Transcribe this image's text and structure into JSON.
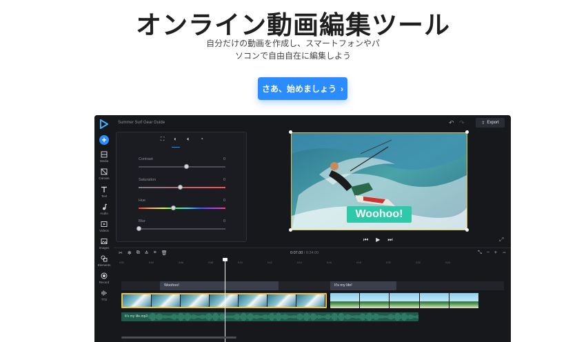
{
  "hero": {
    "title": "オンライン動画編集ツール",
    "subtitle_line1": "自分だけの動画を作成し、スマートフォンやパ",
    "subtitle_line2": "ソコンで自由自在に編集しよう",
    "cta_label": "さあ、始めましょう"
  },
  "app": {
    "project_title": "Summer Surf Gear Guide",
    "export_label": "Export",
    "rail": [
      {
        "label": "Media",
        "icon": "media-icon"
      },
      {
        "label": "Canvas",
        "icon": "canvas-icon"
      },
      {
        "label": "Text",
        "icon": "text-icon"
      },
      {
        "label": "Audio",
        "icon": "audio-icon"
      },
      {
        "label": "Videos",
        "icon": "videos-icon"
      },
      {
        "label": "Images",
        "icon": "images-icon"
      },
      {
        "label": "Elements",
        "icon": "elements-icon"
      },
      {
        "label": "Record",
        "icon": "record-icon"
      },
      {
        "label": "TTS",
        "icon": "tts-icon"
      }
    ],
    "adjustments": [
      {
        "label": "Contrast",
        "value": "0",
        "level": 0.55
      },
      {
        "label": "Saturation",
        "value": "0",
        "level": 0.48
      },
      {
        "label": "Hue",
        "value": "0",
        "level": 0.4
      },
      {
        "label": "Blur",
        "value": "0",
        "level": 0.0
      }
    ],
    "preview_caption": "Woohoo!",
    "timeline": {
      "current_time": "0:07.00",
      "separator": "/",
      "total_time": "0:24.00",
      "ticks": [
        "0:02",
        "0:04",
        "0:06",
        "0:08",
        "0:10",
        "0:12",
        "0:14",
        "0:16",
        "0:18",
        "0:20",
        "0:22",
        "0:24"
      ],
      "text_clips": [
        "Woohoo!",
        "It's my life!"
      ],
      "audio_clip": "It's my life.mp3"
    }
  },
  "colors": {
    "accent": "#2b8cff",
    "app_bg": "#17181c",
    "caption_bg": "#2ec9a8",
    "audio_bg": "#1f5c4b",
    "selection": "#f0c43c"
  }
}
